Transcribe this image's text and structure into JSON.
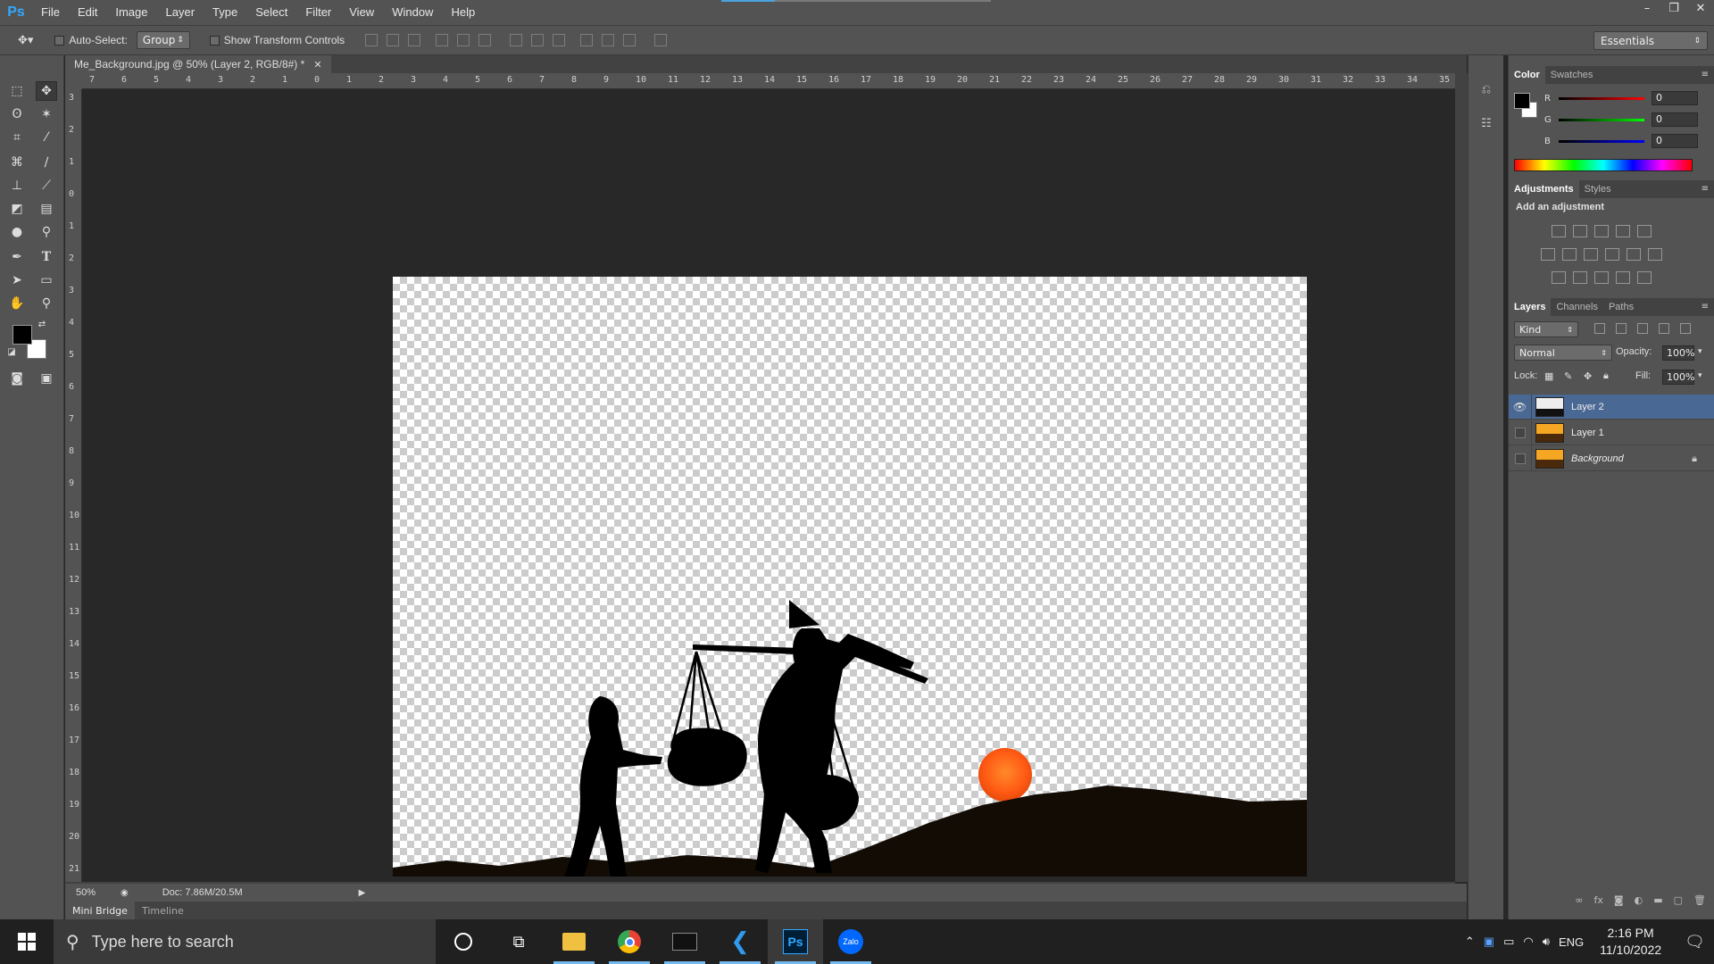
{
  "menubar": {
    "logo": "Ps",
    "items": [
      "File",
      "Edit",
      "Image",
      "Layer",
      "Type",
      "Select",
      "Filter",
      "View",
      "Window",
      "Help"
    ],
    "window_controls": [
      "–",
      "❐",
      "✕"
    ]
  },
  "options": {
    "auto_select_label": "Auto-Select:",
    "auto_select_value": "Group",
    "show_transform_label": "Show Transform Controls",
    "workspace": "Essentials"
  },
  "document": {
    "tab_title": "Me_Background.jpg @ 50% (Layer 2, RGB/8#) *",
    "ruler_top": [
      "7",
      "6",
      "5",
      "4",
      "3",
      "2",
      "1",
      "0",
      "1",
      "2",
      "3",
      "4",
      "5",
      "6",
      "7",
      "8",
      "9",
      "10",
      "11",
      "12",
      "13",
      "14",
      "15",
      "16",
      "17",
      "18",
      "19",
      "20",
      "21",
      "22",
      "23",
      "24",
      "25",
      "26",
      "27",
      "28",
      "29",
      "30",
      "31",
      "32",
      "33",
      "34",
      "35"
    ],
    "ruler_left": [
      "3",
      "2",
      "1",
      "0",
      "1",
      "2",
      "3",
      "4",
      "5",
      "6",
      "7",
      "8",
      "9",
      "10",
      "11",
      "12",
      "13",
      "14",
      "15",
      "16",
      "17",
      "18",
      "19",
      "20",
      "21"
    ],
    "zoom": "50%",
    "doc_info": "Doc: 7.86M/20.5M"
  },
  "bottom_tabs": [
    "Mini Bridge",
    "Timeline"
  ],
  "color_panel": {
    "tabs": [
      "Color",
      "Swatches"
    ],
    "r_label": "R",
    "g_label": "G",
    "b_label": "B",
    "r": "0",
    "g": "0",
    "b": "0"
  },
  "adjustments_panel": {
    "tabs": [
      "Adjustments",
      "Styles"
    ],
    "title": "Add an adjustment"
  },
  "layers_panel": {
    "tabs": [
      "Layers",
      "Channels",
      "Paths"
    ],
    "kind_filter": "Kind",
    "blend_mode": "Normal",
    "opacity_label": "Opacity:",
    "opacity": "100%",
    "lock_label": "Lock:",
    "fill_label": "Fill:",
    "fill": "100%",
    "layers": [
      {
        "name": "Layer 2",
        "visible": true,
        "selected": true
      },
      {
        "name": "Layer 1",
        "visible": false,
        "selected": false
      },
      {
        "name": "Background",
        "visible": false,
        "selected": false
      }
    ]
  },
  "taskbar": {
    "search_placeholder": "Type here to search",
    "language": "ENG",
    "time": "2:16 PM",
    "date": "11/10/2022"
  },
  "colors": {
    "accent_blue": "#31a8ff",
    "selection": "#4a6894",
    "sun": "#ff5a14"
  }
}
